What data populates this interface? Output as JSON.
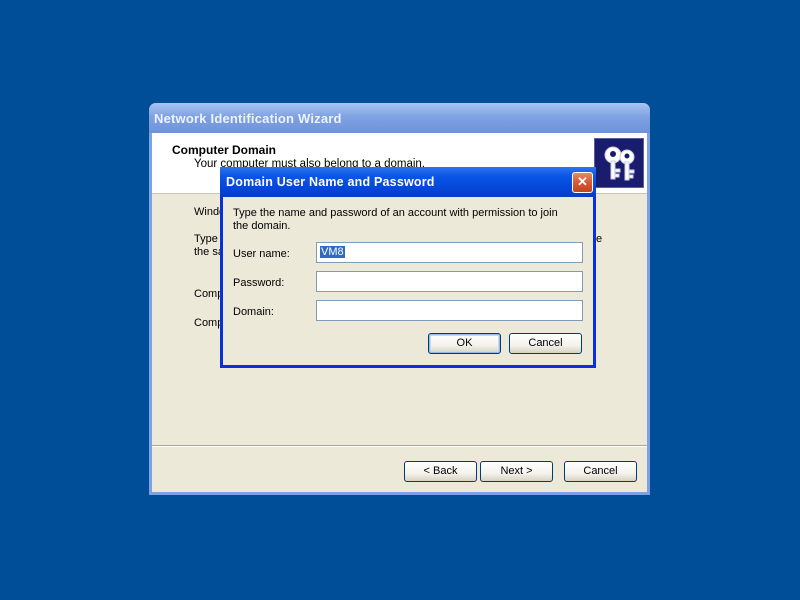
{
  "wizard": {
    "title": "Network Identification Wizard",
    "header_title": "Computer Domain",
    "header_subtitle": "Your computer must also belong to a domain.",
    "body_line1": "Windo",
    "body_line2a": "Type",
    "body_line2b": "the sa",
    "body_line2_right": "e",
    "body_line3": "Comp",
    "body_line4": "Comp",
    "back_label": "< Back",
    "next_label": "Next >",
    "cancel_label": "Cancel",
    "logo_icon": "keys-icon"
  },
  "dialog": {
    "title": "Domain User Name and Password",
    "instructions": "Type the name and password of an account with permission to join the domain.",
    "username_label": "User name:",
    "username_value": "VM8",
    "password_label": "Password:",
    "password_value": "",
    "domain_label": "Domain:",
    "domain_value": "",
    "ok_label": "OK",
    "cancel_label": "Cancel",
    "close_icon": "close-icon"
  },
  "colors": {
    "desktop": "#004e98",
    "dialog_titlebar": "#0a56e6",
    "dialog_face": "#ece9d8",
    "selection": "#316ac5"
  }
}
